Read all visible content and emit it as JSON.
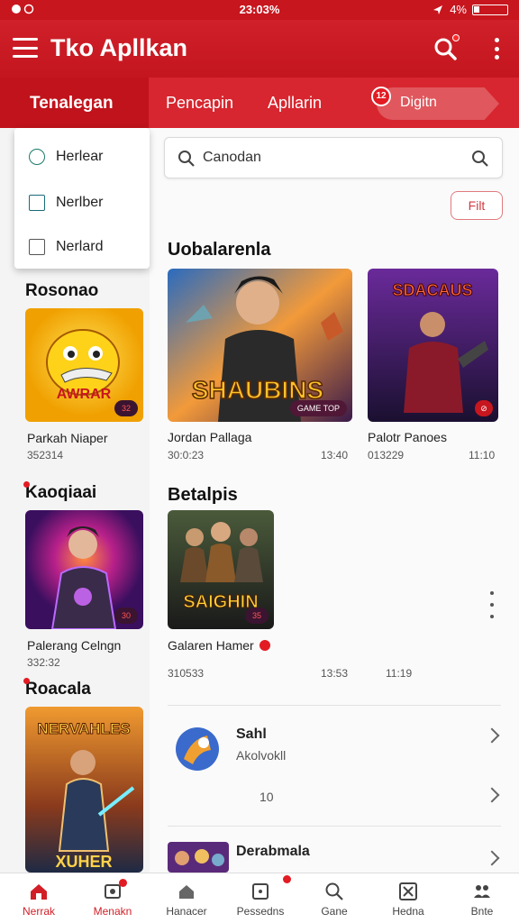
{
  "status_bar": {
    "left_icons": "status-icons",
    "time": "23:03%",
    "battery": "4%"
  },
  "app_bar": {
    "title": "Tko Apllkan"
  },
  "tabs": [
    {
      "label": "Tenalegan",
      "active": true
    },
    {
      "label": "Pencapin"
    },
    {
      "label": "Apllarin"
    },
    {
      "label": "Digitn",
      "badge": "12"
    }
  ],
  "dropdown": [
    {
      "label": "Herlear",
      "icon": "leaf-icon"
    },
    {
      "label": "Nerlber",
      "icon": "check-square-icon"
    },
    {
      "label": "Nerlard",
      "icon": "square-icon"
    }
  ],
  "sidebar": {
    "sections": [
      {
        "title": "Rosonao",
        "item_title": "Parkah Niaper",
        "item_sub": "352314",
        "badge": "32"
      },
      {
        "title": "Kaoqiaai",
        "item_title": "Palerang Celngn",
        "item_sub": "332:32",
        "badge": "30"
      },
      {
        "title": "Roacala",
        "item_title": "",
        "item_sub": ""
      }
    ]
  },
  "main": {
    "search": {
      "value": "Canodan"
    },
    "filter_label": "Filt",
    "section1_title": "Uobalarenla",
    "section1_cards": [
      {
        "title": "Jordan Pallaga",
        "sub": "30:0:23",
        "num": "13:40",
        "tag": "GAME TOP"
      },
      {
        "title": "Palotr Panoes",
        "sub": "013229",
        "num": "11:10"
      }
    ],
    "section2_title": "Betalpis",
    "section2_card": {
      "title": "Galaren Hamer",
      "sub": "310533",
      "num": "13:53",
      "num2": "11:19",
      "badge": "35"
    },
    "list_items": [
      {
        "title": "Sahl",
        "sub": "Akolvokll",
        "stat": "10"
      },
      {
        "title": "Derabmala",
        "sub": ""
      }
    ]
  },
  "bottom_nav": [
    {
      "label": "Nerrak",
      "icon": "home-icon",
      "active": true
    },
    {
      "label": "Menakn",
      "icon": "bell-icon"
    },
    {
      "label": "Hanacer",
      "icon": "house-icon"
    },
    {
      "label": "Pessedns",
      "icon": "tablet-icon"
    },
    {
      "label": "Gane",
      "icon": "search-icon"
    },
    {
      "label": "Hedna",
      "icon": "gamepad-icon"
    },
    {
      "label": "Bnte",
      "icon": "people-icon"
    }
  ],
  "colors": {
    "brand_red": "#d21f27",
    "dark_red": "#c0131b",
    "accent_pill": "#e0575d"
  }
}
